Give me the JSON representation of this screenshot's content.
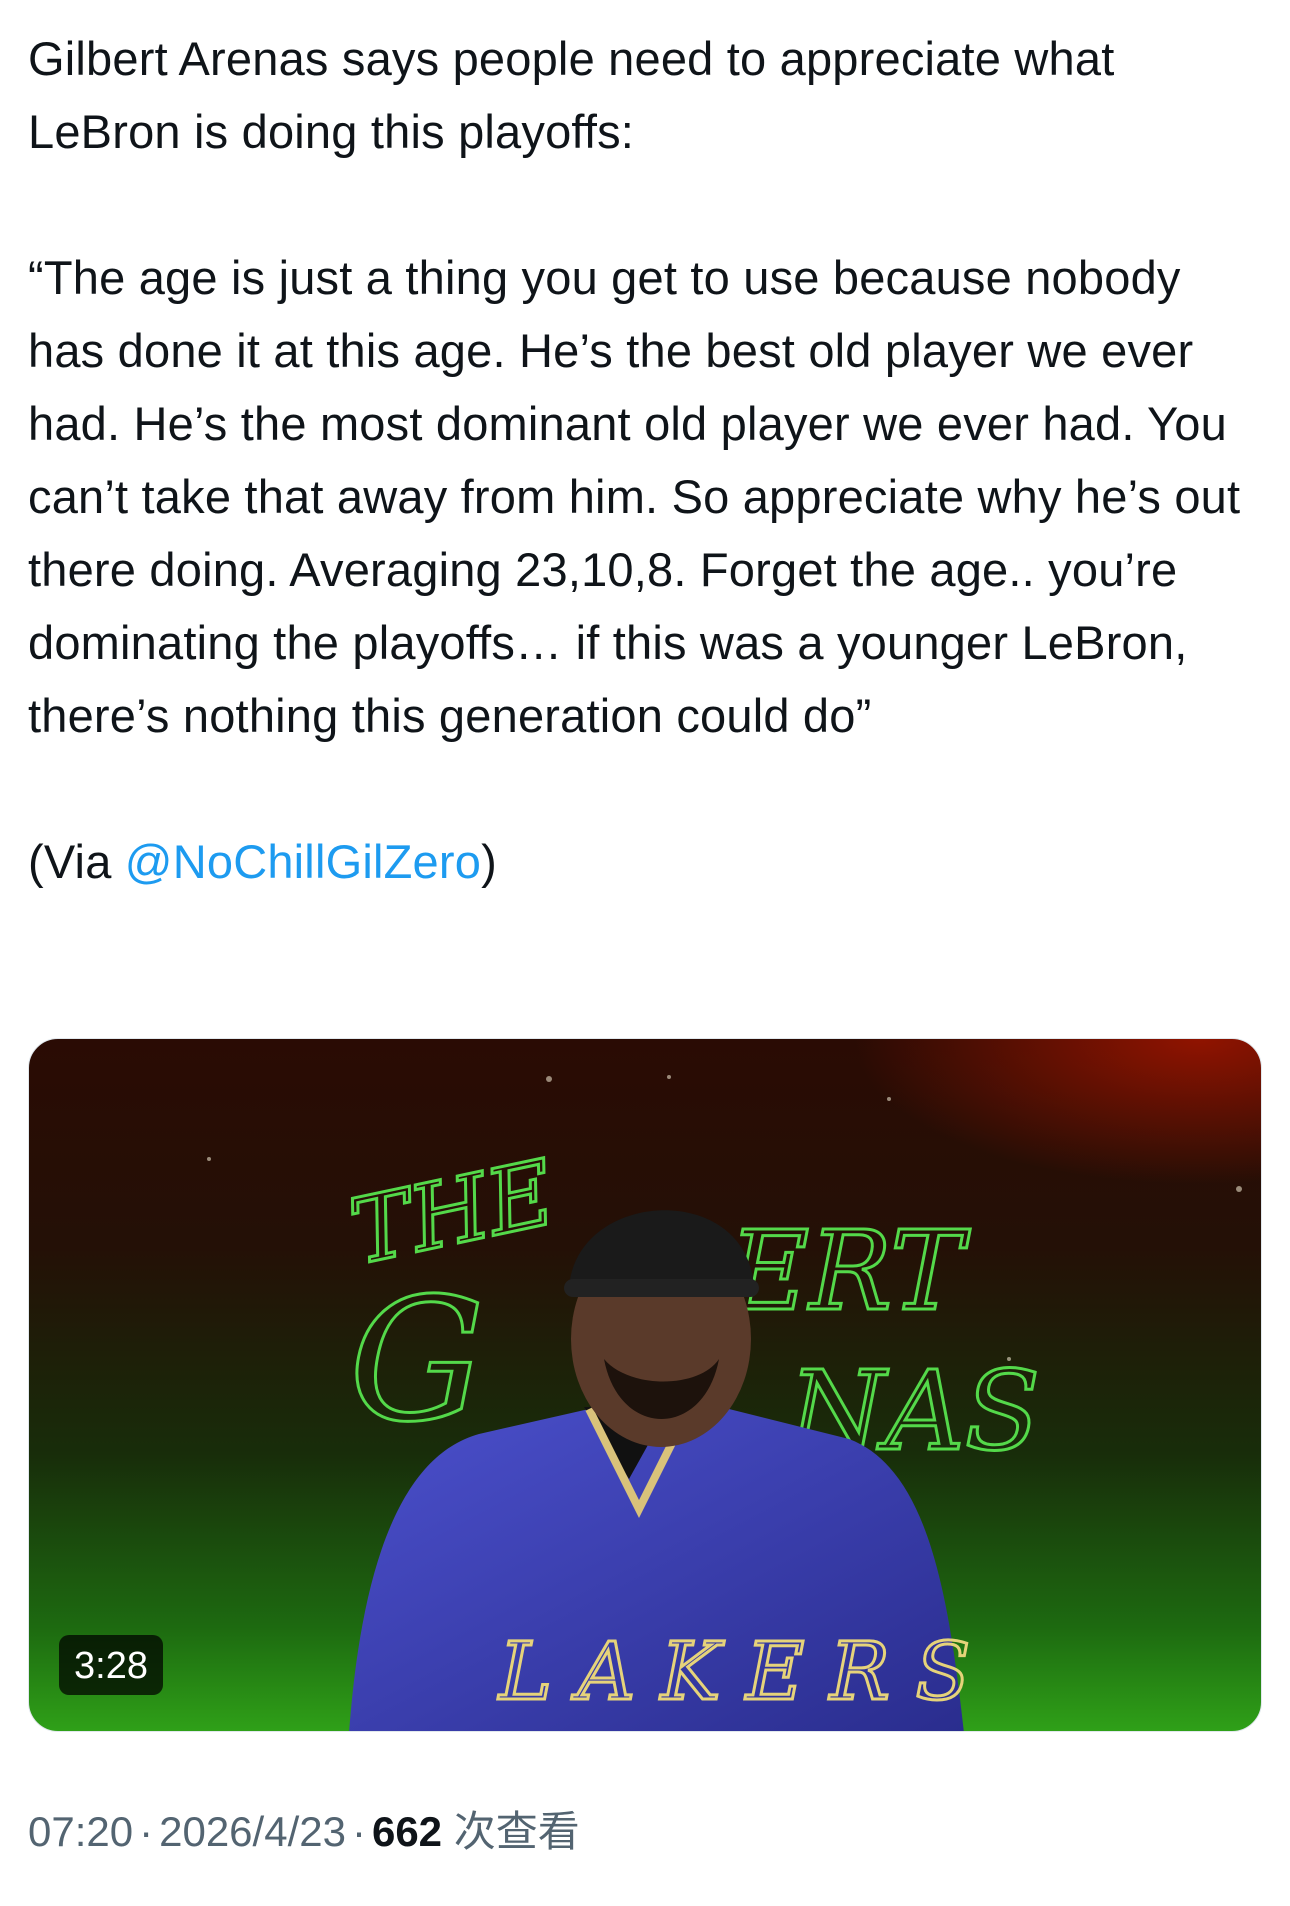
{
  "tweet": {
    "intro_line": "Gilbert Arenas says people need to appreciate what LeBron is doing this playoffs:",
    "quote": "“The age is just a thing you get to use because nobody has done it at this age. He’s the best old player we ever had. He’s the most dominant old player we ever had. You can’t take that away from him. So appreciate why he’s out there doing. Averaging 23,10,8. Forget the age.. you’re dominating the playoffs… if this was a younger LeBron, there’s nothing this generation could do”",
    "via_prefix": "(Via ",
    "via_mention": "@NoChillGilZero",
    "via_suffix": ")"
  },
  "media": {
    "type": "video",
    "duration": "3:28",
    "backdrop_text": "THE GILBERT ARENAS",
    "jacket_text": "LAKERS",
    "colors": {
      "jacket": "#3b3fb6",
      "backdrop_green": "#2fa018",
      "backdrop_red": "#961400"
    }
  },
  "meta": {
    "time": "07:20",
    "separator": "·",
    "date": "2026/4/23",
    "views_count": "662",
    "views_label": "次查看"
  }
}
